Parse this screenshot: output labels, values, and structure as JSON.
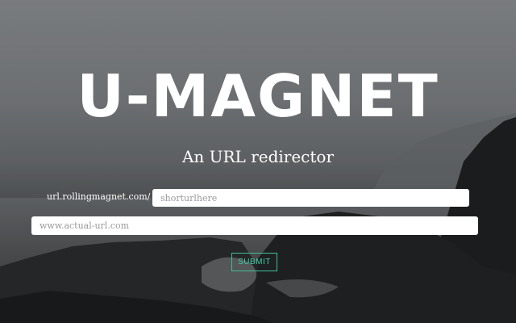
{
  "header": {
    "title": "U-MAGNET",
    "subtitle": "An URL redirector"
  },
  "form": {
    "prefix_label": "url.rollingmagnet.com/",
    "short_placeholder": "shorturlhere",
    "url_placeholder": "www.actual-url.com",
    "submit_label": "SUBMIT"
  },
  "colors": {
    "accent": "#3fd0a8",
    "text": "#ffffff"
  }
}
